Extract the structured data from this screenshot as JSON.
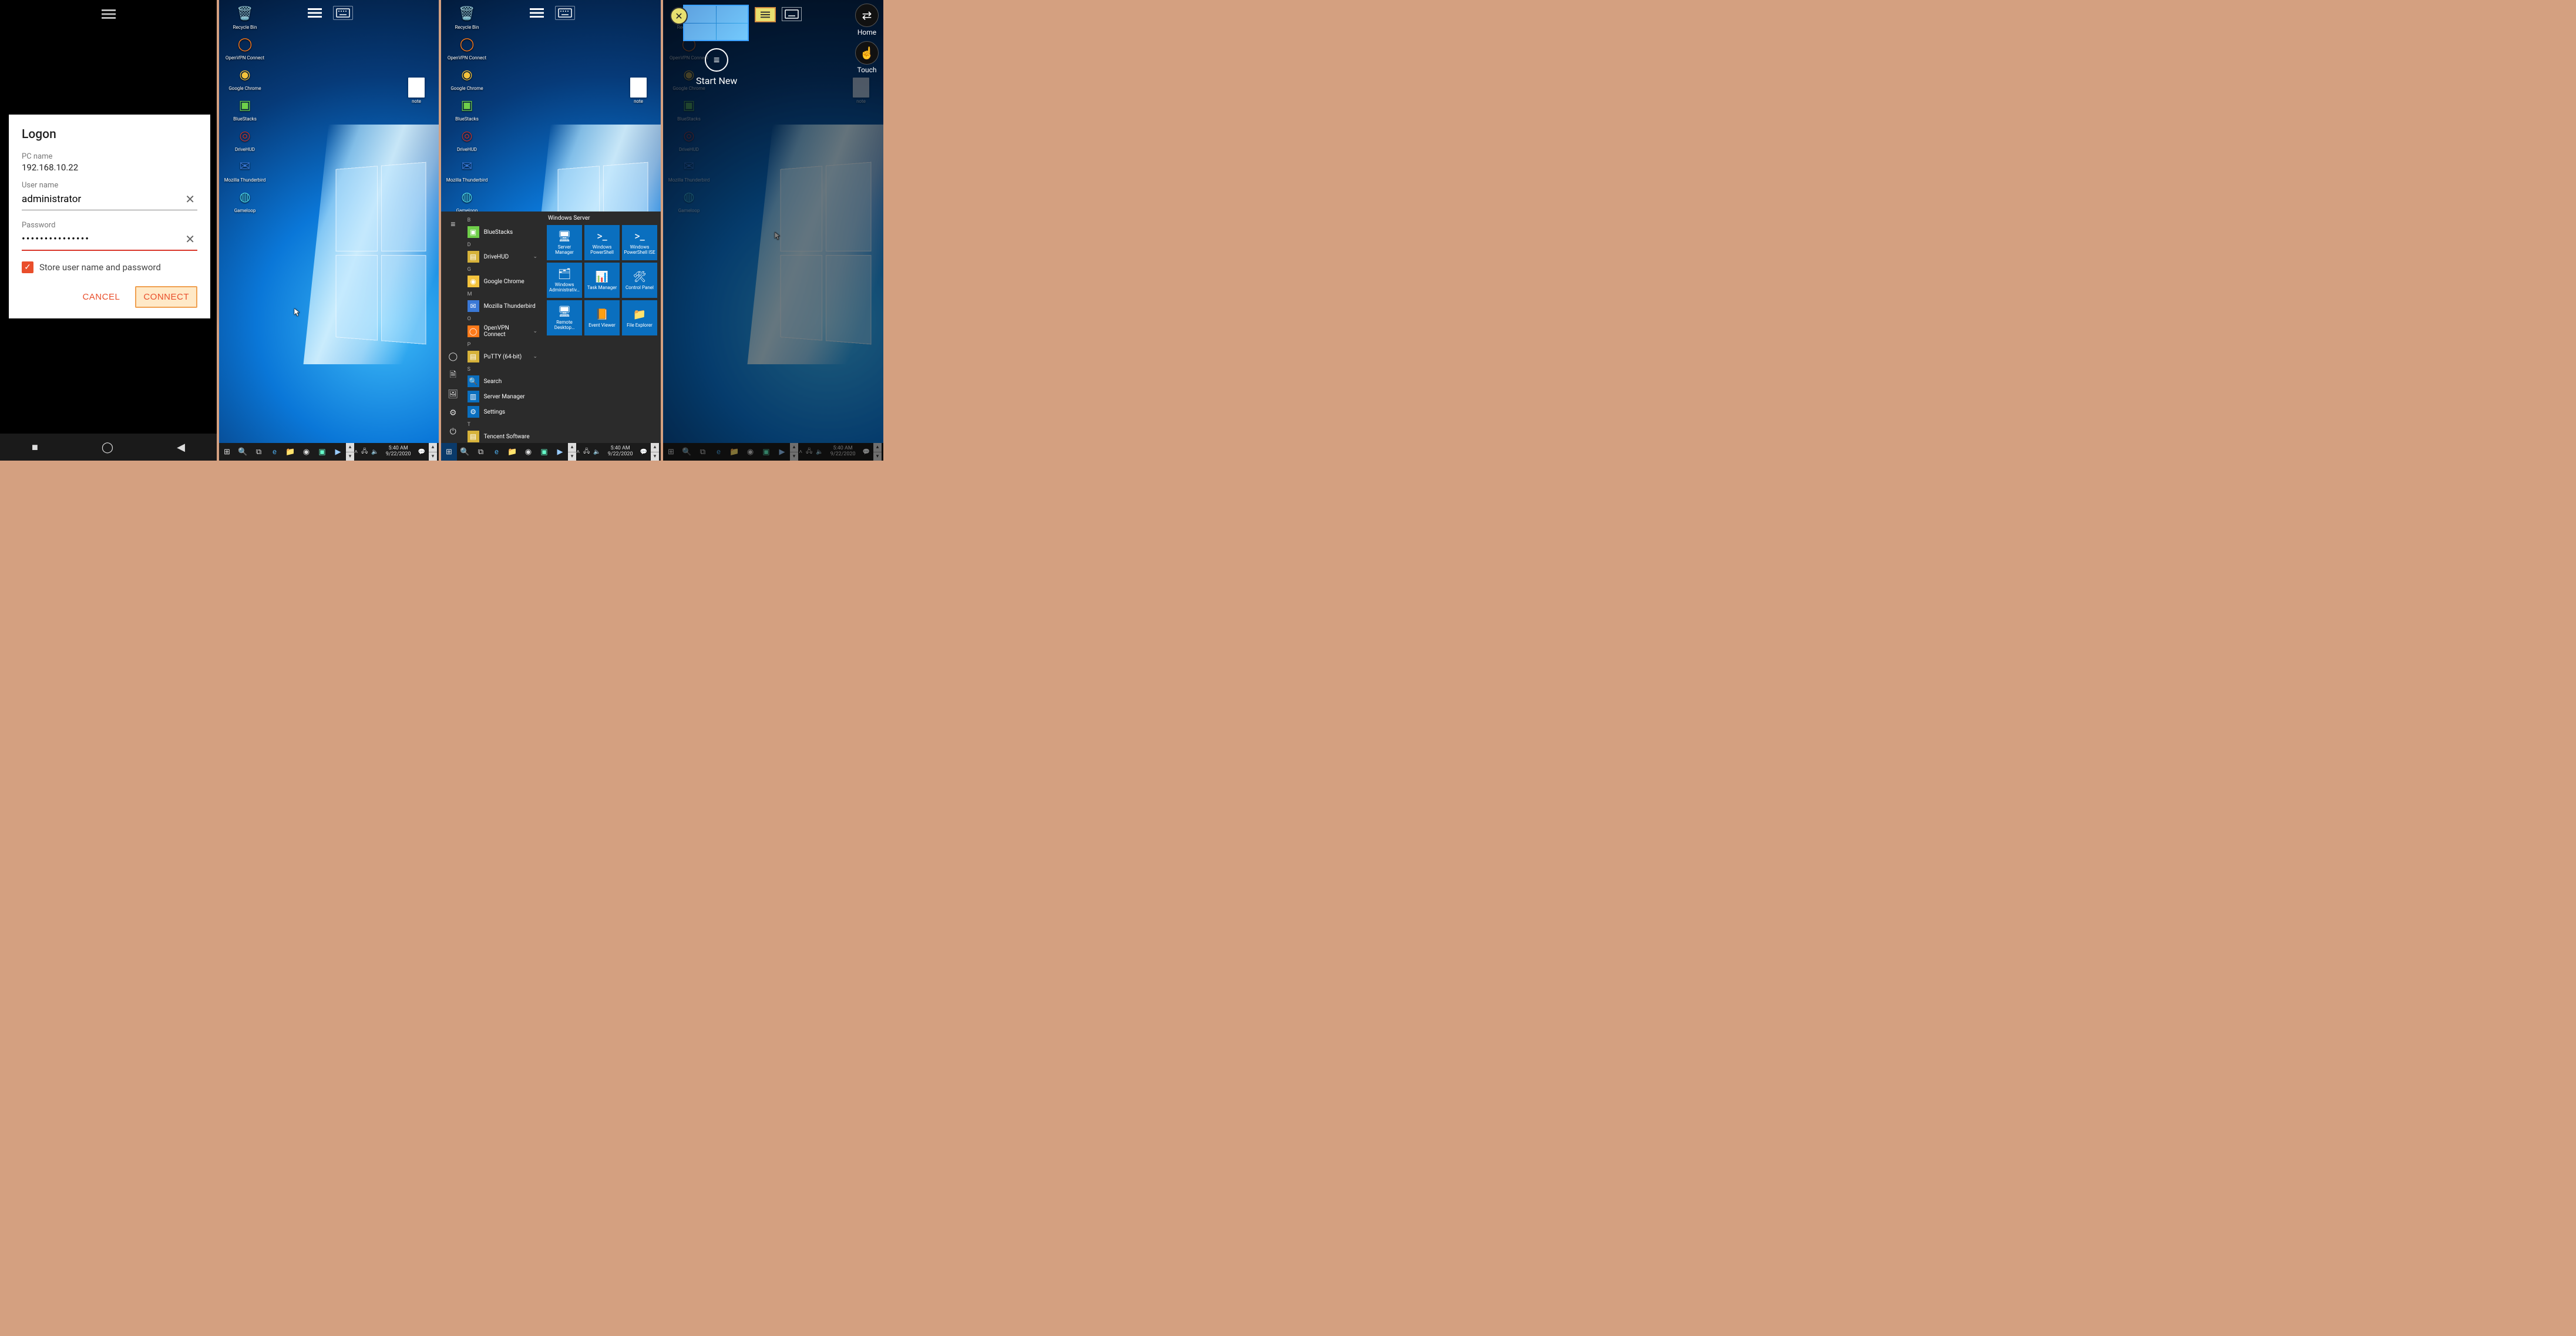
{
  "logon": {
    "title": "Logon",
    "pc_name_label": "PC name",
    "pc_name_value": "192.168.10.22",
    "user_label": "User name",
    "user_value": "administrator",
    "password_label": "Password",
    "password_value": "•••••••••••••••",
    "store_label": "Store user name and password",
    "store_checked": true,
    "cancel": "CANCEL",
    "connect": "CONNECT"
  },
  "desktop_icons": [
    {
      "label": "Recycle Bin",
      "glyph": "🗑️",
      "color": "#5aa9e6"
    },
    {
      "label": "OpenVPN Connect",
      "glyph": "◯",
      "color": "#ff7a1a"
    },
    {
      "label": "Google Chrome",
      "glyph": "◉",
      "color": "#f3c23c"
    },
    {
      "label": "BlueStacks",
      "glyph": "▣",
      "color": "#6fcf4a"
    },
    {
      "label": "DriveHUD",
      "glyph": "◎",
      "color": "#b33"
    },
    {
      "label": "Mozilla Thunderbird",
      "glyph": "✉",
      "color": "#3a78d6"
    },
    {
      "label": "Gameloop",
      "glyph": "◍",
      "color": "#4ad0e6"
    }
  ],
  "note_label": "note",
  "start_menu": {
    "header": "Windows Server",
    "groups": [
      {
        "letter": "B",
        "apps": [
          {
            "name": "BlueStacks",
            "color": "#6fcf4a",
            "glyph": "▣"
          }
        ]
      },
      {
        "letter": "D",
        "apps": [
          {
            "name": "DriveHUD",
            "color": "#d6b23a",
            "glyph": "▤",
            "expandable": true
          }
        ]
      },
      {
        "letter": "G",
        "apps": [
          {
            "name": "Google Chrome",
            "color": "#f3c23c",
            "glyph": "◉"
          }
        ]
      },
      {
        "letter": "M",
        "apps": [
          {
            "name": "Mozilla Thunderbird",
            "color": "#3a78d6",
            "glyph": "✉"
          }
        ]
      },
      {
        "letter": "O",
        "apps": [
          {
            "name": "OpenVPN Connect",
            "color": "#ff7a1a",
            "glyph": "◯",
            "expandable": true
          }
        ]
      },
      {
        "letter": "P",
        "apps": [
          {
            "name": "PuTTY (64-bit)",
            "color": "#d6b23a",
            "glyph": "▤",
            "expandable": true
          }
        ]
      },
      {
        "letter": "S",
        "apps": [
          {
            "name": "Search",
            "color": "#0a6fbf",
            "glyph": "🔍"
          },
          {
            "name": "Server Manager",
            "color": "#0a6fbf",
            "glyph": "▥"
          },
          {
            "name": "Settings",
            "color": "#0a6fbf",
            "glyph": "⚙"
          }
        ]
      },
      {
        "letter": "T",
        "apps": [
          {
            "name": "Tencent Software",
            "color": "#d6b23a",
            "glyph": "▤"
          }
        ]
      }
    ],
    "tiles": [
      {
        "name": "Server Manager",
        "glyph": "🖥"
      },
      {
        "name": "Windows PowerShell",
        "glyph": ">_"
      },
      {
        "name": "Windows PowerShell ISE",
        "glyph": ">_"
      },
      {
        "name": "Windows Administrativ…",
        "glyph": "🗂"
      },
      {
        "name": "Task Manager",
        "glyph": "📊"
      },
      {
        "name": "Control Panel",
        "glyph": "🛠"
      },
      {
        "name": "Remote Desktop…",
        "glyph": "🖥"
      },
      {
        "name": "Event Viewer",
        "glyph": "📙"
      },
      {
        "name": "File Explorer",
        "glyph": "📁"
      }
    ]
  },
  "taskbar": {
    "clock_time": "5:40 AM",
    "clock_date": "9/22/2020"
  },
  "session_switcher": {
    "start_new": "Start New",
    "home": "Home",
    "touch": "Touch"
  }
}
